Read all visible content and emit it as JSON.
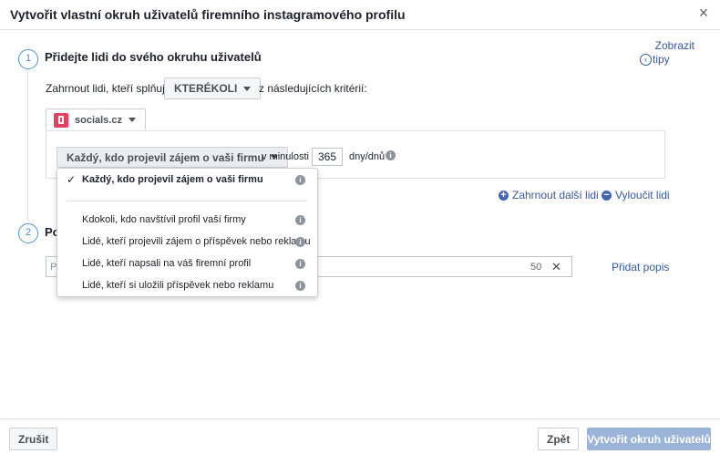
{
  "dialog": {
    "title": "Vytvořit vlastní okruh uživatelů firemního instagramového profilu",
    "close_glyph": "×"
  },
  "tips": {
    "line1": "Zobrazit",
    "line2": "tipy",
    "icon_glyph": "‹"
  },
  "step1": {
    "number": "1",
    "title": "Přidejte lidi do svého okruhu uživatelů",
    "include_prefix": "Zahrnout lidi, kteří splňují",
    "match_select": "KTERÉKOLI",
    "include_suffix": "z následujících kritérií:",
    "source": {
      "name": "socials.cz",
      "logo_color": "#e4405f"
    },
    "criteria": {
      "event_select": "Každý, kdo projevil zájem o vaši firmu",
      "past_label": "v minulosti",
      "days_value": "365",
      "days_unit": "dny/dnů"
    },
    "include_more": "Zahrnout další lidi",
    "exclude": "Vyloučit lidi"
  },
  "step2": {
    "number": "2",
    "title_visible": "Po",
    "input_placeholder_visible": "P",
    "char_count": "50",
    "clear_glyph": "✕",
    "add_description": "Přidat popis"
  },
  "dropdown": {
    "selected": {
      "label": "Každý, kdo projevil zájem o vaši firmu",
      "check": "✓"
    },
    "items": [
      {
        "label": "Kdokoli, kdo navštívil profil vaší firmy"
      },
      {
        "label": "Lidé, kteří projevili zájem o příspěvek nebo reklamu"
      },
      {
        "label": "Lidé, kteří napsali na váš firemní profil"
      },
      {
        "label": "Lidé, kteří si uložili příspěvek nebo reklamu"
      }
    ],
    "info_glyph": "i"
  },
  "footer": {
    "cancel": "Zrušit",
    "back": "Zpět",
    "create": "Vytvořit okruh uživatelů"
  }
}
